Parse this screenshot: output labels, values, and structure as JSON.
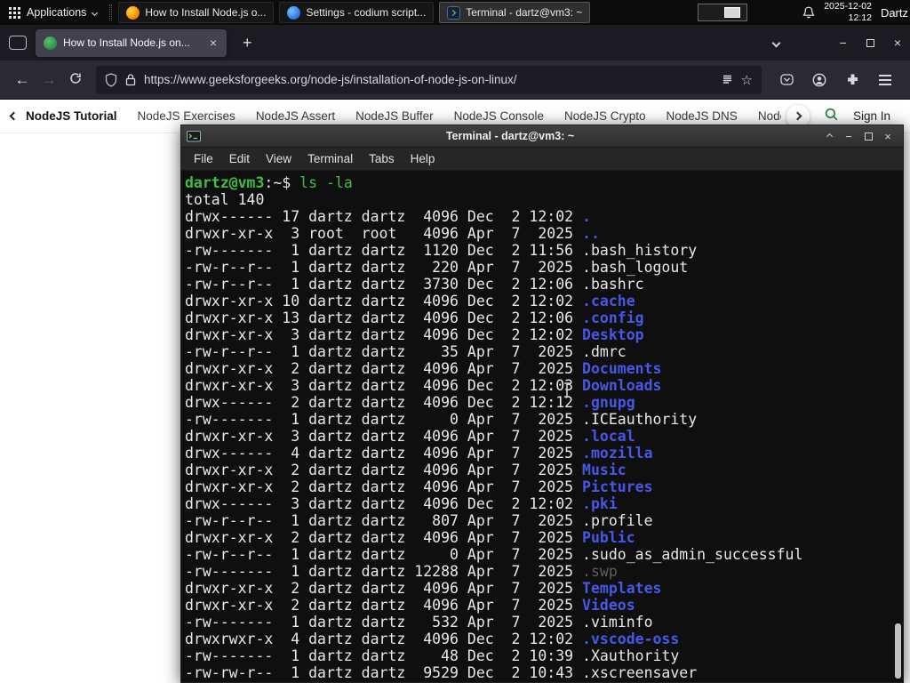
{
  "colors": {
    "gfg-green": "#2f8d46",
    "term-green": "#40bd45",
    "term-blue": "#4757e6",
    "term-dim": "#5f5f5f",
    "term-fg": "#e8e8e8",
    "term-bg": "#0f0f0f"
  },
  "glyphs": {
    "close": "×",
    "plus": "+",
    "minus": "−",
    "back": "←",
    "forward": "→",
    "star": "☆"
  },
  "panel": {
    "applications_label": "Applications",
    "tasks": [
      {
        "label": "How to Install Node.js o...",
        "icon": "firefox"
      },
      {
        "label": "Settings - codium script...",
        "icon": "codium"
      },
      {
        "label": "Terminal - dartz@vm3: ~",
        "icon": "terminal"
      }
    ],
    "date": "2025-12-02",
    "time": "12:12",
    "user": "Dartz"
  },
  "browser": {
    "tab_title": "How to Install Node.js on...",
    "url": "https://www.geeksforgeeks.org/node-js/installation-of-node-js-on-linux/"
  },
  "site_nav": {
    "items": [
      "NodeJS Tutorial",
      "NodeJS Exercises",
      "NodeJS Assert",
      "NodeJS Buffer",
      "NodeJS Console",
      "NodeJS Crypto",
      "NodeJS DNS",
      "Node"
    ],
    "sign_in": "Sign In"
  },
  "terminal": {
    "title": "Terminal - dartz@vm3: ~",
    "menu": [
      "File",
      "Edit",
      "View",
      "Terminal",
      "Tabs",
      "Help"
    ],
    "prompt_user": "dartz@vm3",
    "prompt_sep": ":~$ ",
    "command": "ls -la",
    "total_line": "total 140",
    "entries": [
      {
        "pre": "drwx------ 17 dartz dartz  4096 Dec  2 12:02 ",
        "name": ".",
        "type": "dir"
      },
      {
        "pre": "drwxr-xr-x  3 root  root   4096 Apr  7  2025 ",
        "name": "..",
        "type": "dir"
      },
      {
        "pre": "-rw-------  1 dartz dartz  1120 Dec  2 11:56 ",
        "name": ".bash_history",
        "type": "file"
      },
      {
        "pre": "-rw-r--r--  1 dartz dartz   220 Apr  7  2025 ",
        "name": ".bash_logout",
        "type": "file"
      },
      {
        "pre": "-rw-r--r--  1 dartz dartz  3730 Dec  2 12:06 ",
        "name": ".bashrc",
        "type": "file"
      },
      {
        "pre": "drwxr-xr-x 10 dartz dartz  4096 Dec  2 12:02 ",
        "name": ".cache",
        "type": "dir"
      },
      {
        "pre": "drwxr-xr-x 13 dartz dartz  4096 Dec  2 12:06 ",
        "name": ".config",
        "type": "dir"
      },
      {
        "pre": "drwxr-xr-x  3 dartz dartz  4096 Dec  2 12:02 ",
        "name": "Desktop",
        "type": "dir"
      },
      {
        "pre": "-rw-r--r--  1 dartz dartz    35 Apr  7  2025 ",
        "name": ".dmrc",
        "type": "file"
      },
      {
        "pre": "drwxr-xr-x  2 dartz dartz  4096 Apr  7  2025 ",
        "name": "Documents",
        "type": "dir"
      },
      {
        "pre": "drwxr-xr-x  3 dartz dartz  4096 Dec  2 12:03 ",
        "name": "Downloads",
        "type": "dir"
      },
      {
        "pre": "drwx------  2 dartz dartz  4096 Dec  2 12:12 ",
        "name": ".gnupg",
        "type": "dir"
      },
      {
        "pre": "-rw-------  1 dartz dartz     0 Apr  7  2025 ",
        "name": ".ICEauthority",
        "type": "file"
      },
      {
        "pre": "drwxr-xr-x  3 dartz dartz  4096 Apr  7  2025 ",
        "name": ".local",
        "type": "dir"
      },
      {
        "pre": "drwx------  4 dartz dartz  4096 Apr  7  2025 ",
        "name": ".mozilla",
        "type": "dir"
      },
      {
        "pre": "drwxr-xr-x  2 dartz dartz  4096 Apr  7  2025 ",
        "name": "Music",
        "type": "dir"
      },
      {
        "pre": "drwxr-xr-x  2 dartz dartz  4096 Apr  7  2025 ",
        "name": "Pictures",
        "type": "dir"
      },
      {
        "pre": "drwx------  3 dartz dartz  4096 Dec  2 12:02 ",
        "name": ".pki",
        "type": "dir"
      },
      {
        "pre": "-rw-r--r--  1 dartz dartz   807 Apr  7  2025 ",
        "name": ".profile",
        "type": "file"
      },
      {
        "pre": "drwxr-xr-x  2 dartz dartz  4096 Apr  7  2025 ",
        "name": "Public",
        "type": "dir"
      },
      {
        "pre": "-rw-r--r--  1 dartz dartz     0 Apr  7  2025 ",
        "name": ".sudo_as_admin_successful",
        "type": "file"
      },
      {
        "pre": "-rw-------  1 dartz dartz 12288 Apr  7  2025 ",
        "name": ".swp",
        "type": "dim"
      },
      {
        "pre": "drwxr-xr-x  2 dartz dartz  4096 Apr  7  2025 ",
        "name": "Templates",
        "type": "dir"
      },
      {
        "pre": "drwxr-xr-x  2 dartz dartz  4096 Apr  7  2025 ",
        "name": "Videos",
        "type": "dir"
      },
      {
        "pre": "-rw-------  1 dartz dartz   532 Apr  7  2025 ",
        "name": ".viminfo",
        "type": "file"
      },
      {
        "pre": "drwxrwxr-x  4 dartz dartz  4096 Dec  2 12:02 ",
        "name": ".vscode-oss",
        "type": "dir"
      },
      {
        "pre": "-rw-------  1 dartz dartz    48 Dec  2 10:39 ",
        "name": ".Xauthority",
        "type": "file"
      },
      {
        "pre": "-rw-rw-r--  1 dartz dartz  9529 Dec  2 10:43 ",
        "name": ".xscreensaver",
        "type": "file"
      }
    ]
  }
}
